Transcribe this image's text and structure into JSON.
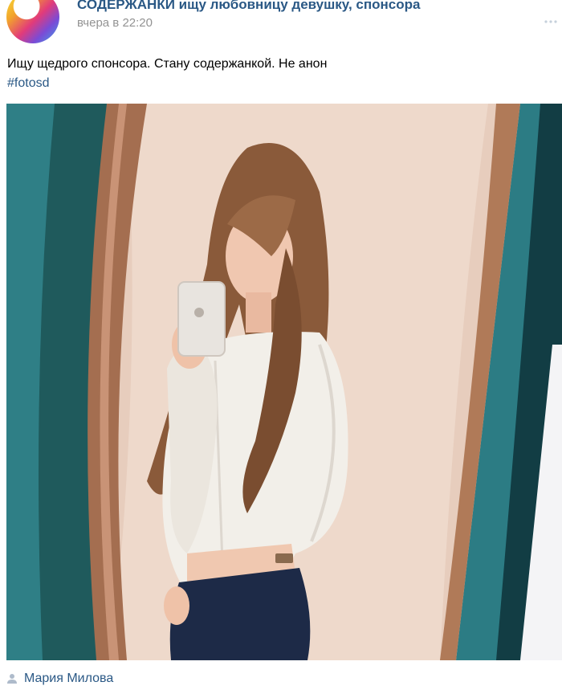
{
  "post": {
    "author": "СОДЕРЖАНКИ ищу любовницу девушку, спонсора",
    "date": "вчера в 22:20",
    "text": "Ищу щедрого спонсора. Стану содержанкой. Не анон",
    "hashtag": "#fotosd",
    "signer": "Мария Милова"
  },
  "icons": {
    "avatar": "community-avatar",
    "more": "more-icon",
    "signer": "user-icon"
  },
  "colors": {
    "link": "#2a5885",
    "meta": "#939393",
    "text": "#000000"
  }
}
